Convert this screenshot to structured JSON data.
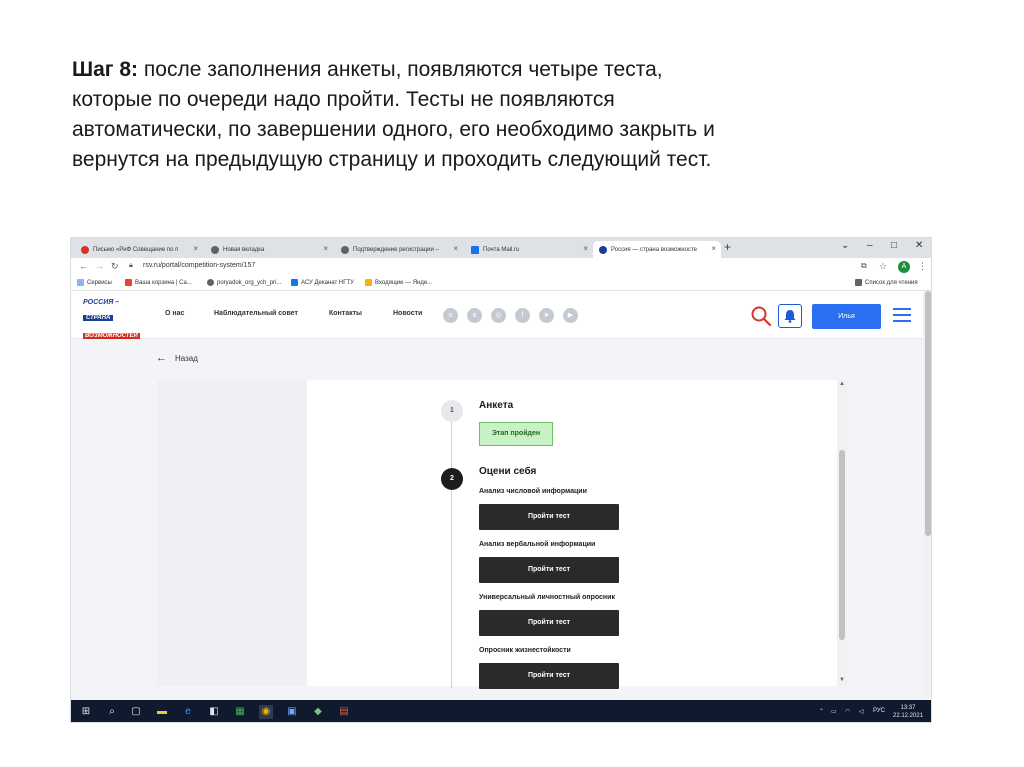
{
  "slide": {
    "step_label": "Шаг 8:",
    "line1": "после заполнения анкеты, появляются четыре теста,",
    "line2": "которые по очереди надо пройти. Тесты не появляются",
    "line3": "автоматически, по завершении одного, его необходимо закрыть и",
    "line4": "вернутся на предыдущую страницу и проходить следующий тест."
  },
  "browser": {
    "tabs": [
      {
        "title": "Письмо «РиФ Совещание по п",
        "close": "×",
        "color": "#d93025"
      },
      {
        "title": "Новая вкладка",
        "close": "×",
        "color": "#5f6368"
      },
      {
        "title": "Подтверждение регистрации –",
        "close": "×",
        "color": "#5f6368"
      },
      {
        "title": "Почта Mail.ru",
        "close": "×",
        "color": "#1a73e8"
      },
      {
        "title": "Россия — страна возможносте",
        "close": "×",
        "color": "#1c3f94"
      }
    ],
    "new_tab": "+",
    "url": "rsv.ru/portal/competition-system/157",
    "profile_initial": "A",
    "bookmarks": [
      {
        "label": "Сервисы",
        "color": "#8ab4f8"
      },
      {
        "label": "Ваша корзина | Са...",
        "color": "#e94235"
      },
      {
        "label": "poryadok_org_ych_pri...",
        "color": "#5f6368"
      },
      {
        "label": "АСУ Деканат НГТУ",
        "color": "#1a73e8"
      },
      {
        "label": "Входящие — Янде...",
        "color": "#f4b400"
      }
    ],
    "reading_list": "Список для чтения"
  },
  "site": {
    "logo": {
      "line1": "РОССИЯ –",
      "line2": "СТРАНА",
      "line3": "ВОЗМОЖНОСТЕЙ"
    },
    "nav": [
      "О нас",
      "Наблюдательный совет",
      "Контакты",
      "Новости"
    ],
    "social_icons": [
      "ok-icon",
      "vk-icon",
      "instagram-icon",
      "facebook-icon",
      "telegram-icon",
      "youtube-icon"
    ],
    "user_button": "Илья",
    "back": "Назад",
    "steps": [
      {
        "number": "1",
        "title": "Анкета",
        "status": "Этап пройден"
      },
      {
        "number": "2",
        "title": "Оцени себя"
      }
    ],
    "tests": [
      {
        "label": "Анализ числовой информации",
        "button": "Пройти тест"
      },
      {
        "label": "Анализ вербальной информации",
        "button": "Пройти тест"
      },
      {
        "label": "Универсальный личностный опросник",
        "button": "Пройти тест"
      },
      {
        "label": "Опросник жизнестойкости",
        "button": "Пройти тест"
      }
    ]
  },
  "taskbar": {
    "lang": "РУС",
    "time": "13:37",
    "date": "22.12.2021"
  },
  "colors": {
    "accent": "#2b6ff3",
    "success_bg": "#c8f1c5",
    "button_dark": "#2a2a2a"
  }
}
